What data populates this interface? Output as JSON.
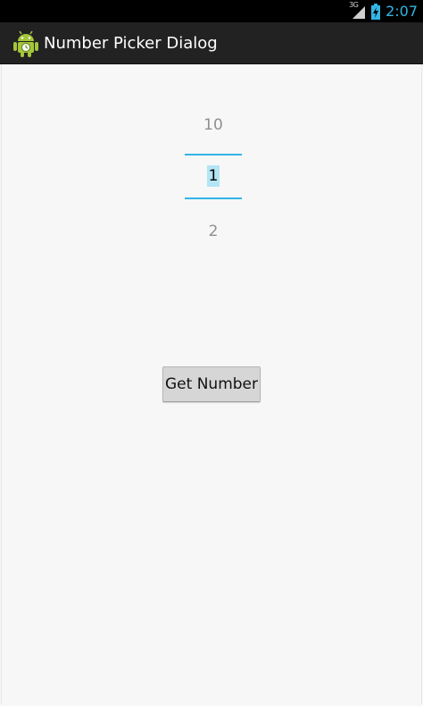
{
  "status_bar": {
    "network_type": "3G",
    "time": "2:07",
    "icons": [
      "signal-icon",
      "battery-charging-icon"
    ],
    "accent_color": "#33b5e5"
  },
  "action_bar": {
    "app_icon": "android-icon",
    "title": "Number Picker Dialog",
    "background_color": "#222222"
  },
  "number_picker": {
    "previous_value": "10",
    "current_value": "1",
    "next_value": "2",
    "divider_color": "#33b5e5"
  },
  "button": {
    "label": "Get Number"
  }
}
